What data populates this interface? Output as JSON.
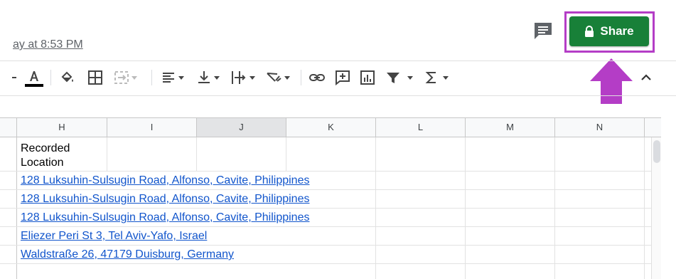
{
  "header": {
    "last_edit": "ay at 8:53 PM",
    "share_label": "Share"
  },
  "colors": {
    "share_green": "#188038",
    "highlight_purple": "#b43dc6",
    "link_blue": "#1155cc"
  },
  "toolbar": {
    "icons": [
      "text-color-icon",
      "fill-color-icon",
      "borders-icon",
      "merge-cells-icon",
      "align-horizontal-icon",
      "align-vertical-icon",
      "text-wrap-icon",
      "text-rotation-icon",
      "link-icon",
      "comment-icon",
      "chart-icon",
      "filter-icon",
      "functions-icon",
      "collapse-toolbar-icon"
    ]
  },
  "grid": {
    "columns": [
      "H",
      "I",
      "J",
      "K",
      "L",
      "M",
      "N"
    ],
    "selected_column": "J",
    "header_cell": {
      "line1": "Recorded",
      "line2": "Location"
    },
    "rows": [
      "128 Luksuhin-Sulsugin Road, Alfonso, Cavite, Philippines",
      "128 Luksuhin-Sulsugin Road, Alfonso, Cavite, Philippines",
      "128 Luksuhin-Sulsugin Road, Alfonso, Cavite, Philippines",
      "Eliezer Peri St 3, Tel Aviv-Yafo, Israel",
      "Waldstraße 26, 47179 Duisburg, Germany"
    ]
  }
}
